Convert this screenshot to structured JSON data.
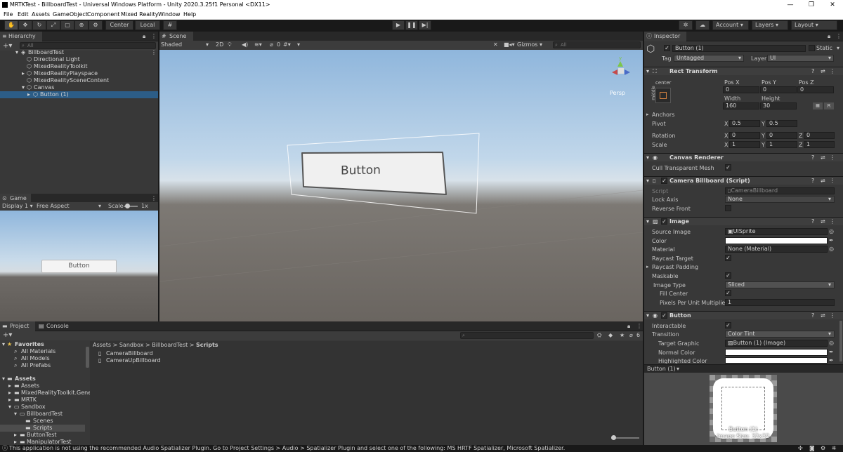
{
  "window": {
    "title": "MRTKTest - BillboardTest - Universal Windows Platform - Unity 2020.3.25f1 Personal <DX11>",
    "minimize": "—",
    "maximize": "❐",
    "close": "✕"
  },
  "menu": [
    "File",
    "Edit",
    "Assets",
    "GameObject",
    "Component",
    "Mixed Reality",
    "Window",
    "Help"
  ],
  "toolbar": {
    "pivot": "Center",
    "space": "Local",
    "account": "Account",
    "layers": "Layers",
    "layout": "Layout"
  },
  "hierarchy": {
    "tab": "Hierarchy",
    "search_placeholder": "All",
    "items": [
      {
        "label": "BillboardTest",
        "indent": 0,
        "selected": false
      },
      {
        "label": "Directional Light",
        "indent": 1,
        "selected": false
      },
      {
        "label": "MixedRealityToolkit",
        "indent": 1,
        "selected": false
      },
      {
        "label": "MixedRealityPlayspace",
        "indent": 1,
        "selected": false
      },
      {
        "label": "MixedRealitySceneContent",
        "indent": 1,
        "selected": false
      },
      {
        "label": "Canvas",
        "indent": 1,
        "selected": false
      },
      {
        "label": "Button (1)",
        "indent": 2,
        "selected": true
      }
    ]
  },
  "scene": {
    "tab": "Scene",
    "shading": "Shaded",
    "mode2d": "2D",
    "hidden_count": "0",
    "gizmos": "Gizmos",
    "search_placeholder": "All",
    "persp": "Persp",
    "button_label": "Button"
  },
  "game": {
    "tab": "Game",
    "display": "Display 1",
    "aspect": "Free Aspect",
    "scale_label": "Scale",
    "scale_value": "1x",
    "button_label": "Button"
  },
  "project": {
    "tab_project": "Project",
    "tab_console": "Console",
    "hidden_count": "6",
    "breadcrumb": [
      "Assets",
      "Sandbox",
      "BillboardTest",
      "Scripts"
    ],
    "favorites_label": "Favorites",
    "favorites": [
      "All Materials",
      "All Models",
      "All Prefabs"
    ],
    "assets_label": "Assets",
    "tree": [
      {
        "label": "Assets",
        "indent": 1
      },
      {
        "label": "MixedRealityToolkit.Gene",
        "indent": 1
      },
      {
        "label": "MRTK",
        "indent": 1
      },
      {
        "label": "Sandbox",
        "indent": 1
      },
      {
        "label": "BillboardTest",
        "indent": 2
      },
      {
        "label": "Scenes",
        "indent": 3
      },
      {
        "label": "Scripts",
        "indent": 3,
        "selected": true
      },
      {
        "label": "ButtonTest",
        "indent": 2
      },
      {
        "label": "ManipulatorTest",
        "indent": 2
      }
    ],
    "files": [
      "CameraBillboard",
      "CameraUpBillboard"
    ]
  },
  "inspector": {
    "tab": "Inspector",
    "object_name": "Button (1)",
    "static": "Static",
    "tag_label": "Tag",
    "tag": "Untagged",
    "layer_label": "Layer",
    "layer": "UI",
    "rect": {
      "title": "Rect Transform",
      "anchor_label": "center",
      "anchor_side": "middle",
      "posx_label": "Pos X",
      "posy_label": "Pos Y",
      "posz_label": "Pos Z",
      "posx": "0",
      "posy": "0",
      "posz": "0",
      "width_label": "Width",
      "height_label": "Height",
      "width": "160",
      "height": "30",
      "r_btn": "R",
      "anchors": "Anchors",
      "pivot": "Pivot",
      "pivot_x": "0.5",
      "pivot_y": "0.5",
      "rotation": "Rotation",
      "rot_x": "0",
      "rot_y": "0",
      "rot_z": "0",
      "scale": "Scale",
      "scale_x": "1",
      "scale_y": "1",
      "scale_z": "1",
      "x": "X",
      "y": "Y",
      "z": "Z"
    },
    "canvas_renderer": {
      "title": "Canvas Renderer",
      "cull_label": "Cull Transparent Mesh"
    },
    "billboard": {
      "title": "Camera Billboard (Script)",
      "script_label": "Script",
      "script": "CameraBillboard",
      "lock_label": "Lock Axis",
      "lock": "None",
      "reverse_label": "Reverse Front"
    },
    "image": {
      "title": "Image",
      "source_label": "Source Image",
      "source": "UISprite",
      "color_label": "Color",
      "material_label": "Material",
      "material": "None (Material)",
      "raycast_label": "Raycast Target",
      "padding_label": "Raycast Padding",
      "maskable_label": "Maskable",
      "type_label": "Image Type",
      "type": "Sliced",
      "fill_label": "Fill Center",
      "ppu_label": "Pixels Per Unit Multiplier",
      "ppu": "1"
    },
    "button": {
      "title": "Button",
      "interactable_label": "Interactable",
      "transition_label": "Transition",
      "transition": "Color Tint",
      "target_label": "Target Graphic",
      "target": "Button (1) (Image)",
      "normal_label": "Normal Color",
      "highlight_label": "Highlighted Color"
    },
    "preview": {
      "title": "Button (1)",
      "caption1": "Button (1)",
      "caption2": "Image Size: 32x32"
    }
  },
  "status": {
    "message": "This application is not using the recommended Audio Spatializer Plugin. Go to Project Settings > Audio > Spatializer Plugin and select one of the following: MS HRTF Spatializer, Microsoft Spatializer."
  },
  "colors": {
    "selection": "#2c5d87",
    "panel": "#383838"
  }
}
